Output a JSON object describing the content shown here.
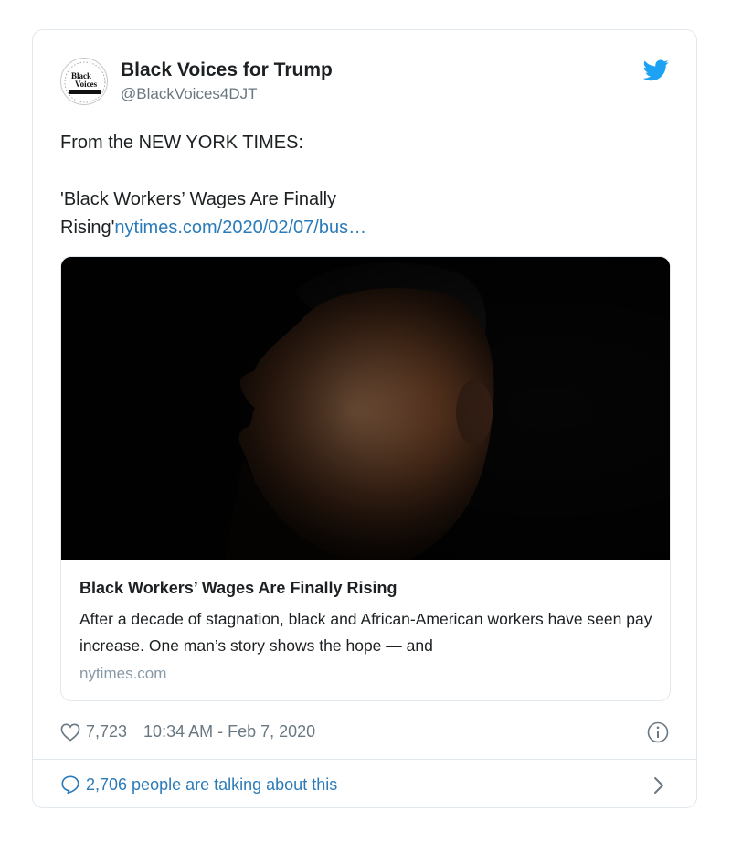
{
  "author": {
    "name": "Black Voices for Trump",
    "handle": "@BlackVoices4DJT",
    "avatar_text": "Black Voices FOR TRUMP"
  },
  "tweet": {
    "line1": "From the NEW YORK TIMES:",
    "line2": "'Black Workers’ Wages Are Finally",
    "line3": "Rising'",
    "link": "nytimes.com/2020/02/07/bus…"
  },
  "card": {
    "title": "Black Workers’ Wages Are Finally Rising",
    "description": "After a decade of stagnation, black and African-American workers have seen pay increase. One man’s story shows the hope — and",
    "domain": "nytimes.com"
  },
  "meta": {
    "likes": "7,723",
    "timestamp": "10:34 AM - Feb 7, 2020"
  },
  "conversation": {
    "label": "2,706 people are talking about this"
  },
  "colors": {
    "link": "#2b7bb9",
    "muted": "#697882",
    "border": "#e1e8ed",
    "twitter_blue": "#1da1f2"
  },
  "icons": [
    "twitter-bird-icon",
    "heart-icon",
    "info-icon",
    "speech-bubble-icon",
    "chevron-right-icon"
  ]
}
